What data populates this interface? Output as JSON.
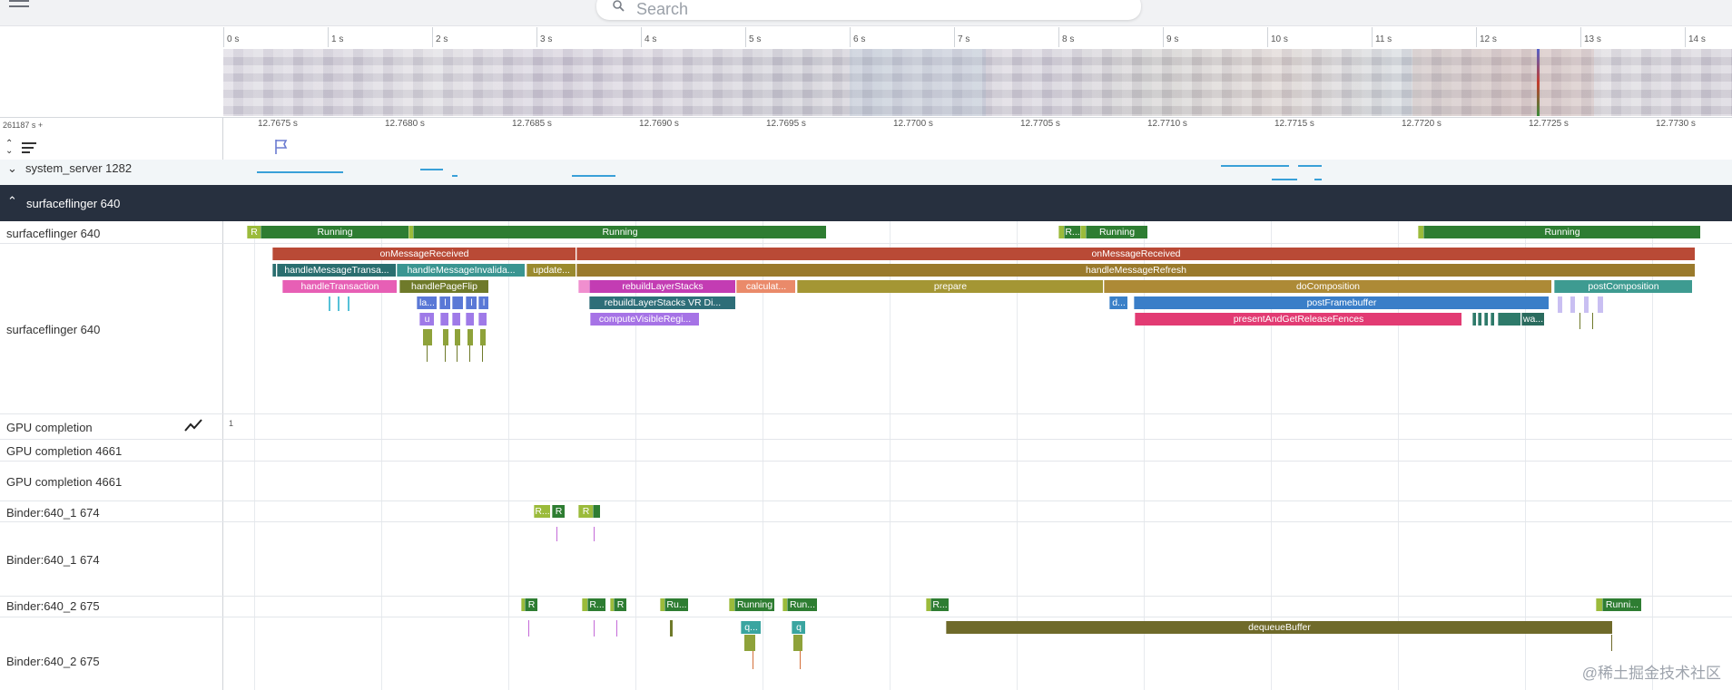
{
  "search": {
    "placeholder": "Search"
  },
  "overview_ticks": [
    "0 s",
    "1 s",
    "2 s",
    "3 s",
    "4 s",
    "5 s",
    "6 s",
    "7 s",
    "8 s",
    "9 s",
    "10 s",
    "11 s",
    "12 s",
    "13 s",
    "14 s"
  ],
  "offset_label": "261187 s +",
  "detail_ticks": [
    "12.7675 s",
    "12.7680 s",
    "12.7685 s",
    "12.7690 s",
    "12.7695 s",
    "12.7700 s",
    "12.7705 s",
    "12.7710 s",
    "12.7715 s",
    "12.7720 s",
    "12.7725 s",
    "12.7730 s"
  ],
  "tracks": {
    "system_server": "system_server 1282",
    "sf_group": "surfaceflinger 640",
    "sf_thread": "surfaceflinger 640",
    "sf_slices": "surfaceflinger 640",
    "gpu": "GPU completion",
    "gpu_value": "1",
    "gpu_4661_a": "GPU completion 4661",
    "gpu_4661_b": "GPU completion 4661",
    "binder1_state": "Binder:640_1 674",
    "binder1_slices": "Binder:640_1 674",
    "binder2_state": "Binder:640_2 675",
    "binder2_slices": "Binder:640_2 675"
  },
  "slices": {
    "s01": "R",
    "s02": "Running",
    "s03": "Running",
    "s04": "R...",
    "s05": "Running",
    "s06": "Running",
    "s10": "onMessageReceived",
    "s11": "onMessageReceived",
    "s12": "handleMessageTransa...",
    "s13": "handleMessageInvalida...",
    "s14": "update...",
    "s15": "handleMessageRefresh",
    "s16": "handleTransaction",
    "s17": "handlePageFlip",
    "s18": "rebuildLayerStacks",
    "s19": "calculat...",
    "s20": "prepare",
    "s21": "doComposition",
    "s22": "postComposition",
    "s23": "la...",
    "s24": "l",
    "s25": "l",
    "s26": "l",
    "s27": "rebuildLayerStacks VR Di...",
    "s28": "d...",
    "s29": "postFramebuffer",
    "s30": "u",
    "s31": "computeVisibleRegi...",
    "s32": "presentAndGetReleaseFences",
    "s33": "wa...",
    "b1": "R...",
    "b2": "R",
    "b3": "R",
    "c1": "R",
    "c2": "R...",
    "c3": "R",
    "c4": "Ru...",
    "c5": "Running",
    "c6": "Run...",
    "c7": "R...",
    "c8": "Runni...",
    "c9": "q...",
    "c10": "q",
    "c11": "dequeueBuffer"
  },
  "colors": {
    "header_bg": "#27303f",
    "running": "#2e7d32",
    "runnable": "#9bbb3b"
  },
  "watermark": "@稀土掘金技术社区"
}
